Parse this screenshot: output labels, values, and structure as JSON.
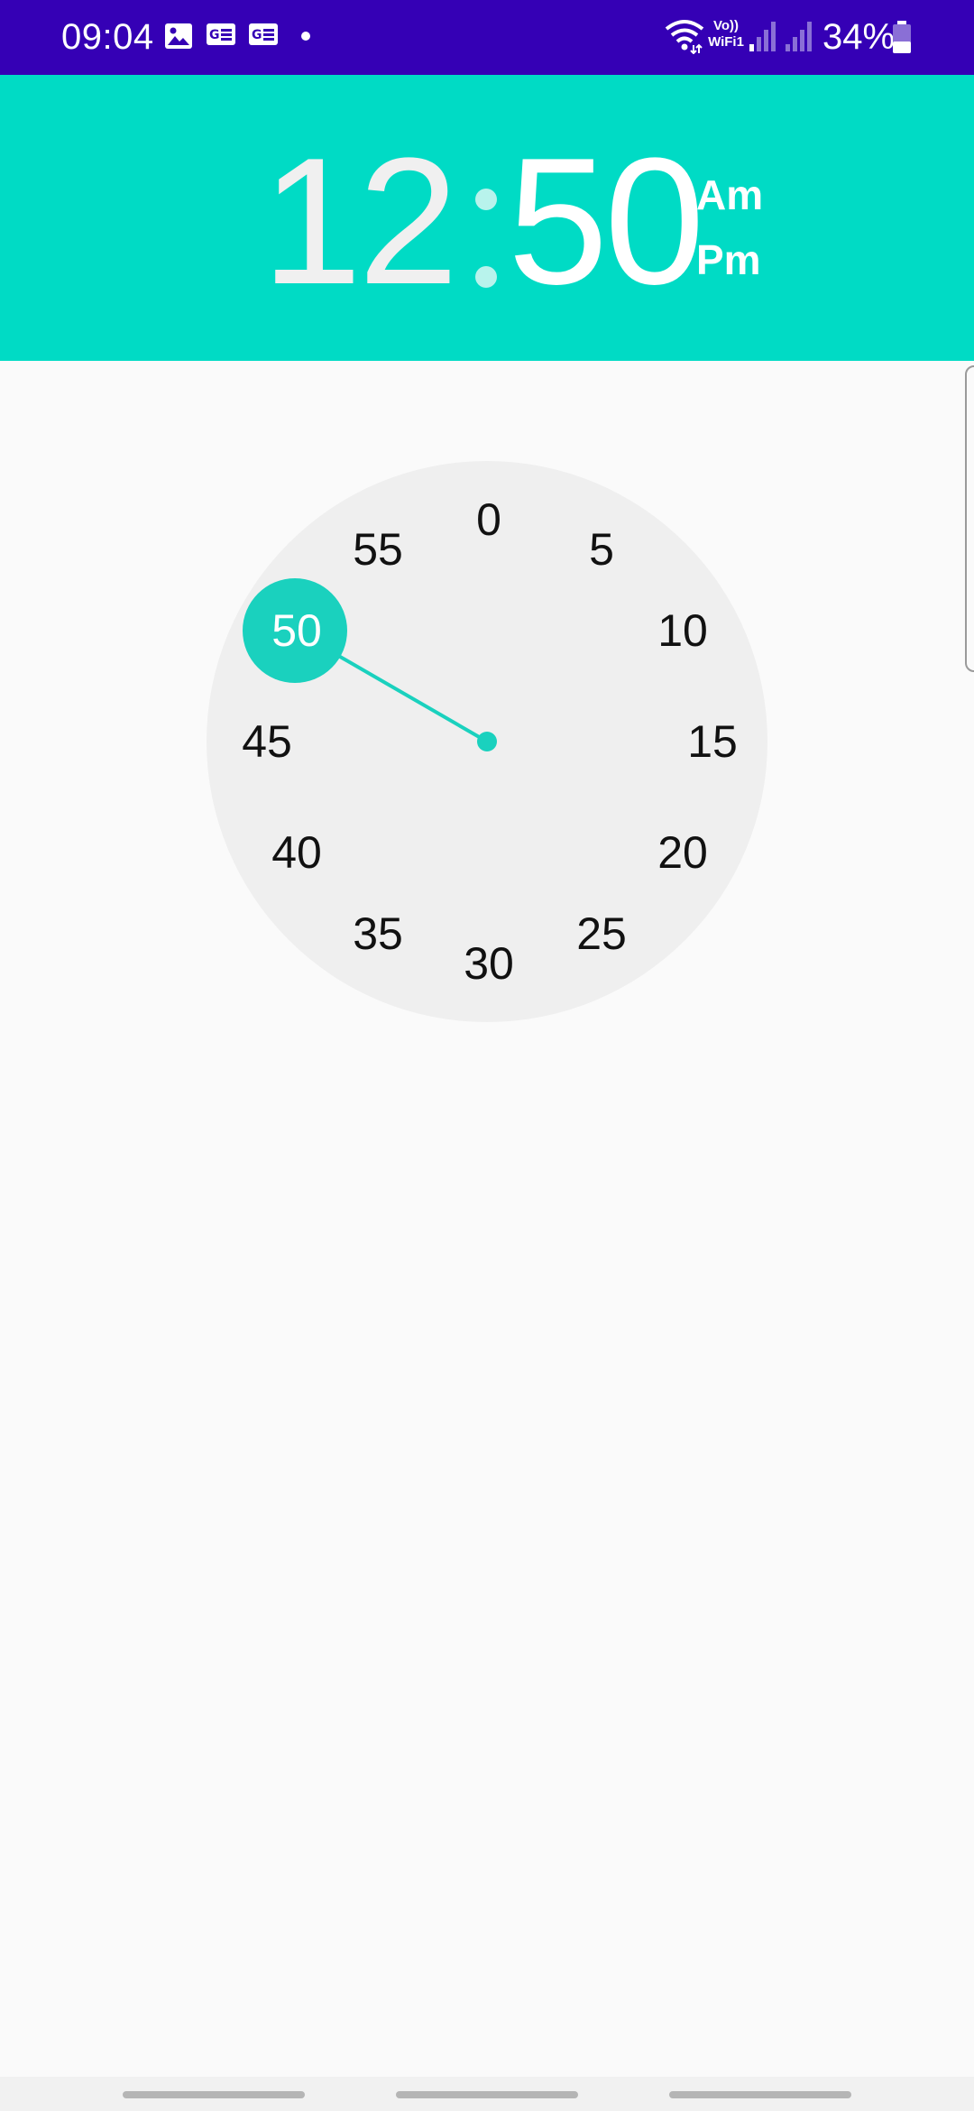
{
  "status_bar": {
    "time": "09:04",
    "battery": "34%",
    "background_color": "#3500b5",
    "notification_icons": [
      "image-icon",
      "news-icon",
      "news-icon"
    ],
    "status_icons": [
      "wifi-icon",
      "volte-wifi-icon",
      "signal-icon",
      "signal-icon",
      "battery-icon"
    ],
    "volte_label_top": "Vo))",
    "volte_label_bottom": "WiFi1"
  },
  "header": {
    "hour": "12",
    "minute": "50",
    "am_label": "Am",
    "pm_label": "Pm",
    "background_color": "#00dbc5"
  },
  "clock": {
    "mode": "minutes",
    "selected_value": 50,
    "numbers": [
      "0",
      "5",
      "10",
      "15",
      "20",
      "25",
      "30",
      "35",
      "40",
      "45",
      "50",
      "55"
    ],
    "accent_color": "#1ad1be",
    "face_color": "#efefef"
  }
}
